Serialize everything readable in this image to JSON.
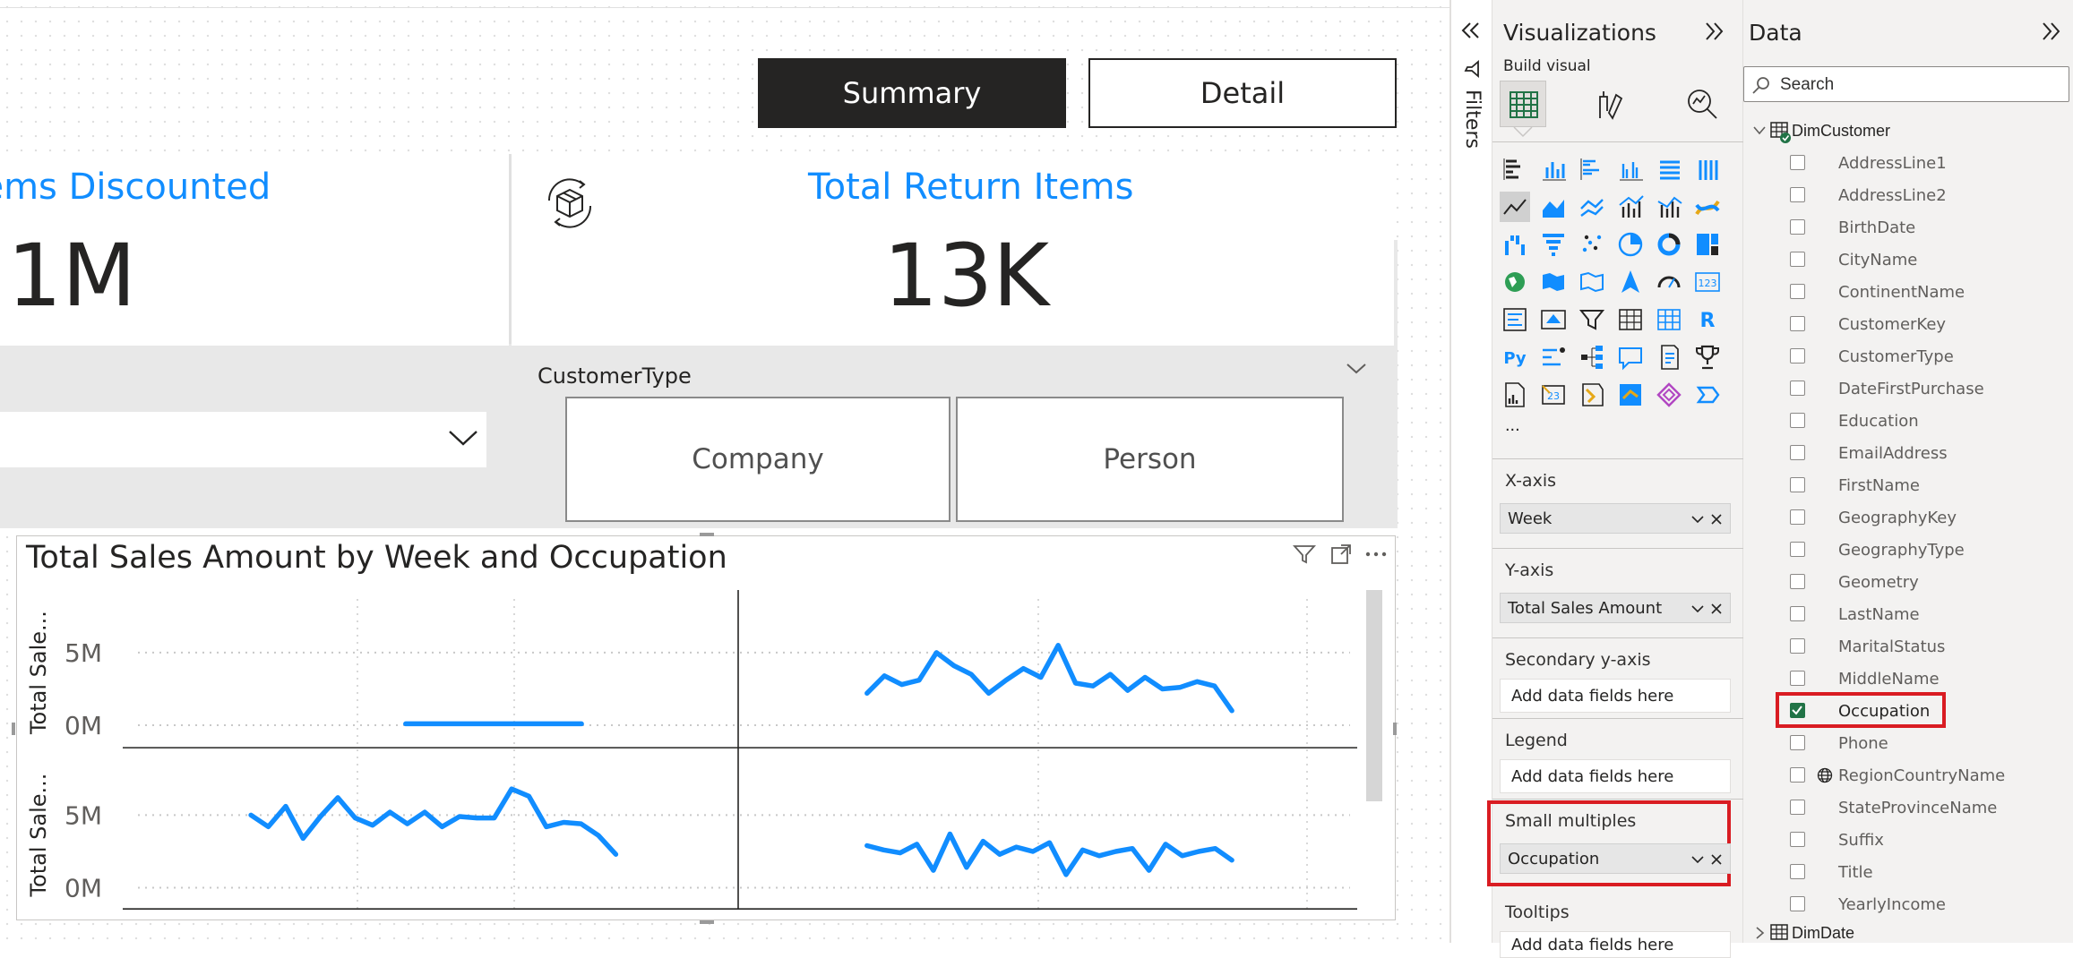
{
  "nav_buttons": {
    "summary": "Summary",
    "detail": "Detail"
  },
  "kpis": [
    {
      "title": "Items Discounted",
      "value": "1M"
    },
    {
      "title": "Total Return Items",
      "value": "13K"
    }
  ],
  "customer_type_slicer": {
    "label": "CustomerType",
    "options": [
      "Company",
      "Person"
    ]
  },
  "visual": {
    "title": "Total Sales Amount by Week and Occupation",
    "y_axis_label": "Total Sale...",
    "ticks": [
      "5M",
      "0M"
    ]
  },
  "chart_data": {
    "type": "line",
    "title": "Total Sales Amount by Week and Occupation",
    "xlabel": "",
    "ylabel": "Total Sale...",
    "ylim": [
      0,
      7
    ],
    "yticks": [
      "5M",
      "0M"
    ],
    "small_multiples": [
      {
        "panel": "top-left",
        "values": [
          0.1,
          0.1,
          0.1,
          0.1,
          0.1,
          0.1,
          0.1,
          0.1,
          0.1,
          0.1,
          0.1
        ]
      },
      {
        "panel": "top-right",
        "values": [
          2.2,
          3.4,
          2.8,
          3.1,
          5.0,
          4.1,
          3.5,
          2.2,
          3.1,
          3.9,
          3.3,
          5.5,
          2.9,
          2.7,
          3.5,
          2.4,
          3.3,
          2.5,
          2.6,
          3.0,
          2.7,
          1.0
        ]
      },
      {
        "panel": "bottom-left",
        "values": [
          5.0,
          4.2,
          5.6,
          3.4,
          4.9,
          6.2,
          4.8,
          4.3,
          5.2,
          4.4,
          5.2,
          4.2,
          4.9,
          4.8,
          4.8,
          6.8,
          6.3,
          4.2,
          4.5,
          4.4,
          3.6,
          2.3
        ]
      },
      {
        "panel": "bottom-right",
        "values": [
          2.9,
          2.6,
          2.4,
          3.0,
          1.2,
          3.7,
          1.4,
          3.2,
          2.3,
          2.8,
          2.5,
          3.1,
          0.9,
          2.6,
          2.2,
          2.5,
          2.7,
          1.2,
          3.0,
          2.2,
          2.5,
          2.7,
          1.9
        ]
      }
    ],
    "grid": true,
    "legend": "none"
  },
  "filters_pane": {
    "label": "Filters"
  },
  "viz_pane": {
    "title": "Visualizations",
    "build_visual": "Build visual",
    "more": "...",
    "wells": [
      {
        "label": "X-axis",
        "field": "Week"
      },
      {
        "label": "Y-axis",
        "field": "Total Sales Amount"
      },
      {
        "label": "Secondary y-axis",
        "placeholder": "Add data fields here"
      },
      {
        "label": "Legend",
        "placeholder": "Add data fields here"
      },
      {
        "label": "Small multiples",
        "field": "Occupation"
      },
      {
        "label": "Tooltips",
        "placeholder": "Add data fields here"
      }
    ],
    "highlight_color": "#D91C22"
  },
  "data_pane": {
    "title": "Data",
    "search_placeholder": "Search",
    "table": "DimCustomer",
    "fields": [
      {
        "name": "AddressLine1",
        "checked": false
      },
      {
        "name": "AddressLine2",
        "checked": false
      },
      {
        "name": "BirthDate",
        "checked": false
      },
      {
        "name": "CityName",
        "checked": false
      },
      {
        "name": "ContinentName",
        "checked": false
      },
      {
        "name": "CustomerKey",
        "checked": false
      },
      {
        "name": "CustomerType",
        "checked": false
      },
      {
        "name": "DateFirstPurchase",
        "checked": false
      },
      {
        "name": "Education",
        "checked": false
      },
      {
        "name": "EmailAddress",
        "checked": false
      },
      {
        "name": "FirstName",
        "checked": false
      },
      {
        "name": "GeographyKey",
        "checked": false
      },
      {
        "name": "GeographyType",
        "checked": false
      },
      {
        "name": "Geometry",
        "checked": false
      },
      {
        "name": "LastName",
        "checked": false
      },
      {
        "name": "MaritalStatus",
        "checked": false
      },
      {
        "name": "MiddleName",
        "checked": false
      },
      {
        "name": "Occupation",
        "checked": true
      },
      {
        "name": "Phone",
        "checked": false
      },
      {
        "name": "RegionCountryName",
        "checked": false
      },
      {
        "name": "StateProvinceName",
        "checked": false
      },
      {
        "name": "Suffix",
        "checked": false
      },
      {
        "name": "Title",
        "checked": false
      },
      {
        "name": "YearlyIncome",
        "checked": false
      }
    ],
    "next_table": "DimDate"
  },
  "colors": {
    "accent": "#118DFF",
    "line": "#118DFF",
    "check": "#217346",
    "highlight": "#D91C22"
  }
}
